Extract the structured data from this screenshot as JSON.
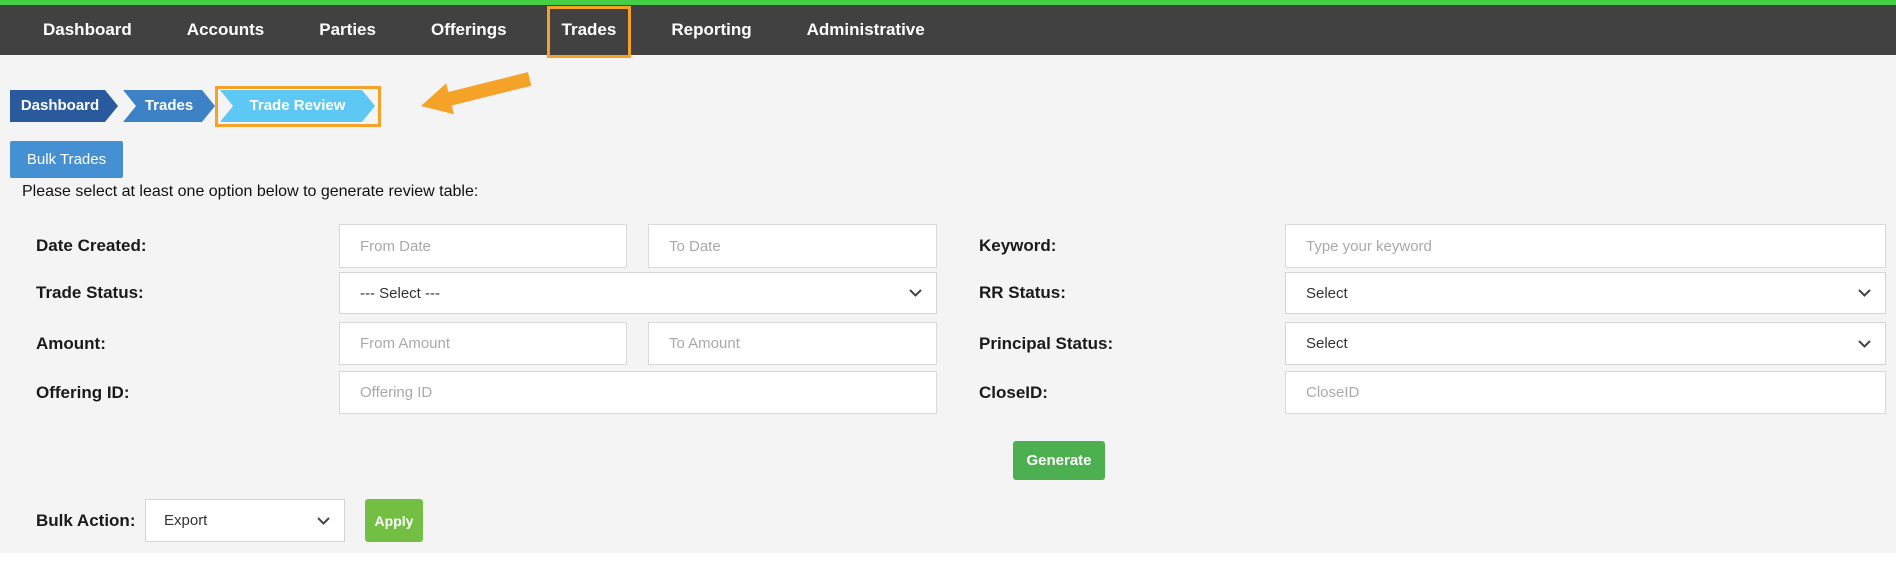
{
  "nav": {
    "items": [
      {
        "label": "Dashboard"
      },
      {
        "label": "Accounts"
      },
      {
        "label": "Parties"
      },
      {
        "label": "Offerings"
      },
      {
        "label": "Trades",
        "highlighted": true
      },
      {
        "label": "Reporting"
      },
      {
        "label": "Administrative"
      }
    ]
  },
  "breadcrumb": {
    "items": [
      {
        "label": "Dashboard"
      },
      {
        "label": "Trades"
      },
      {
        "label": "Trade Review",
        "highlighted": true
      }
    ]
  },
  "toolbar": {
    "bulk_trades_label": "Bulk Trades"
  },
  "instruction": "Please select at least one option below to generate review table:",
  "form": {
    "left": [
      {
        "label": "Date Created:",
        "inputs": [
          {
            "placeholder": "From Date"
          },
          {
            "placeholder": "To Date"
          }
        ]
      },
      {
        "label": "Trade Status:",
        "select_value": "--- Select ---"
      },
      {
        "label": "Amount:",
        "inputs": [
          {
            "placeholder": "From Amount"
          },
          {
            "placeholder": "To Amount"
          }
        ]
      },
      {
        "label": "Offering ID:",
        "input_placeholder": "Offering ID"
      }
    ],
    "right": [
      {
        "label": "Keyword:",
        "input_placeholder": "Type your keyword"
      },
      {
        "label": "RR Status:",
        "select_value": "Select"
      },
      {
        "label": "Principal Status:",
        "select_value": "Select"
      },
      {
        "label": "CloseID:",
        "input_placeholder": "CloseID"
      }
    ],
    "generate_label": "Generate"
  },
  "bulk_action": {
    "label": "Bulk Action:",
    "select_value": "Export",
    "apply_label": "Apply"
  },
  "colors": {
    "top_strip_green": "#45cf45",
    "navbar_bg": "#414141",
    "annotation_orange": "#f5a228",
    "breadcrumb_dashboard": "#2a5a9e",
    "breadcrumb_trades": "#3d82c4",
    "breadcrumb_trade_review": "#5cc8f3",
    "bulk_trades_blue": "#458fd3",
    "generate_green": "#4caf50",
    "apply_green": "#72bf44",
    "content_bg": "#f4f4f5"
  }
}
